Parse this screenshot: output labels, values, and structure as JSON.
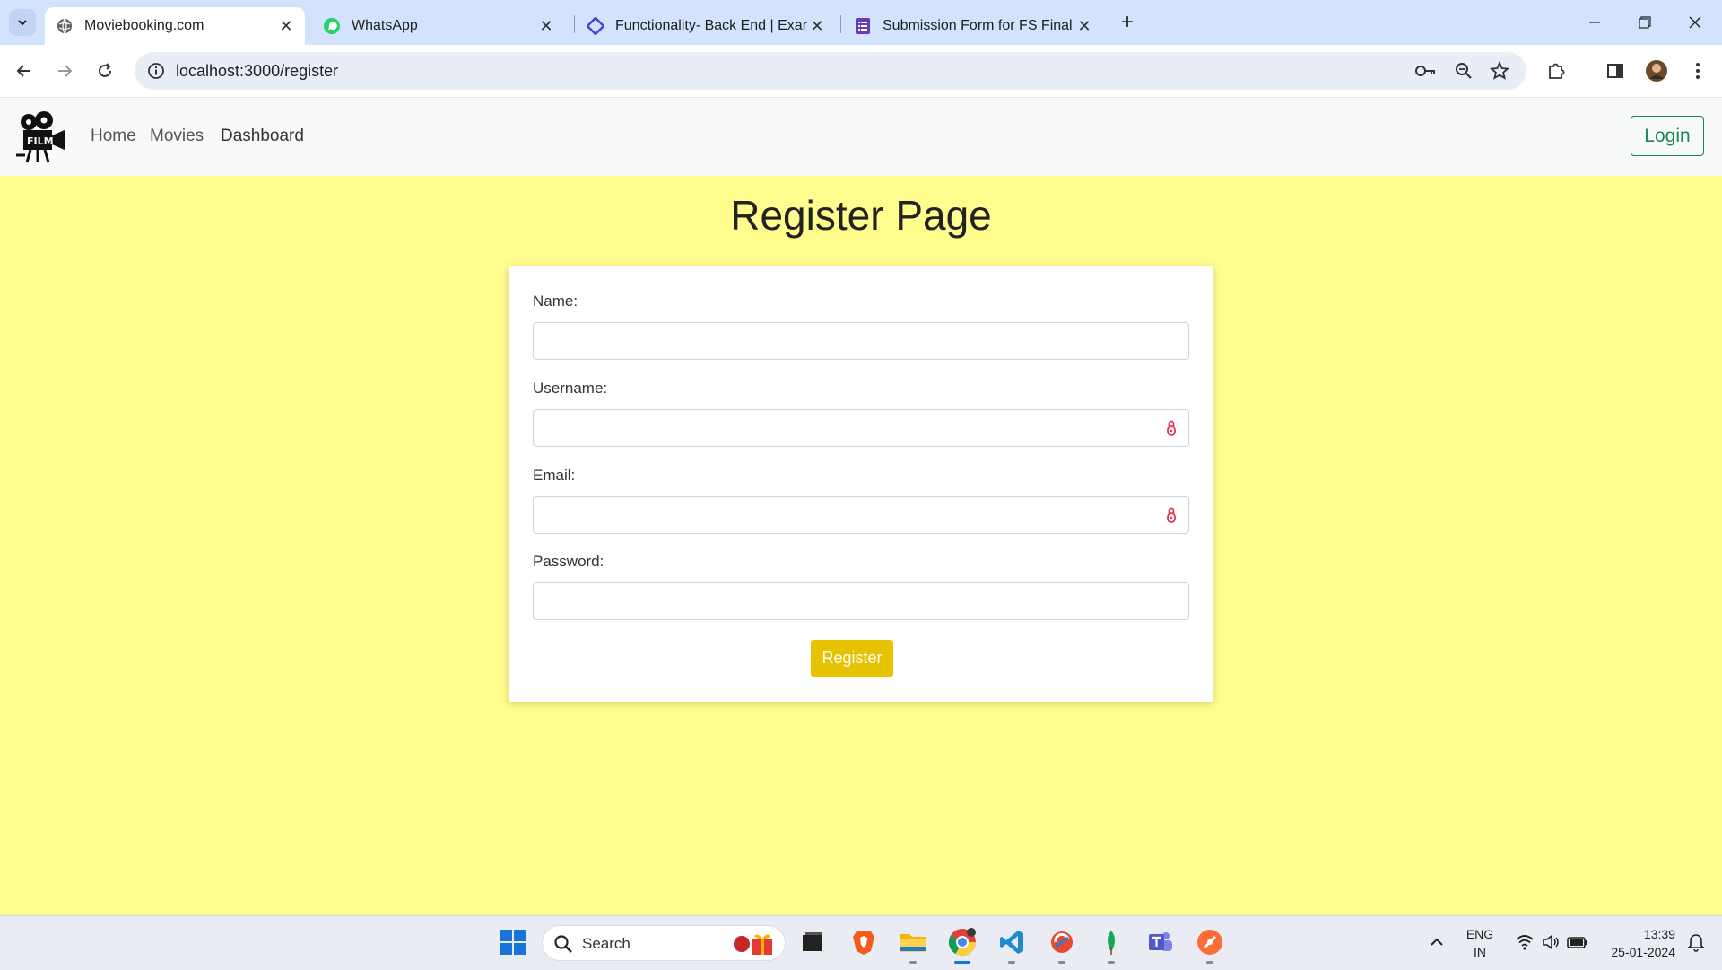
{
  "browser": {
    "tabs": [
      {
        "title": "Moviebooking.com",
        "favicon": "globe-icon",
        "active": true
      },
      {
        "title": "WhatsApp",
        "favicon": "whatsapp-icon",
        "active": false
      },
      {
        "title": "Functionality- Back End | Exam",
        "favicon": "diamond-code-icon",
        "active": false
      },
      {
        "title": "Submission Form for FS Final Ex",
        "favicon": "forms-icon",
        "active": false
      }
    ],
    "url": "localhost:3000/register"
  },
  "navbar": {
    "brand_logo_text": "FILM",
    "links": [
      "Home",
      "Movies",
      "Dashboard"
    ],
    "login_label": "Login"
  },
  "page": {
    "title": "Register Page",
    "form": {
      "fields": [
        {
          "label": "Name:",
          "value": "",
          "has_password_manager_icon": false
        },
        {
          "label": "Username:",
          "value": "",
          "has_password_manager_icon": true
        },
        {
          "label": "Email:",
          "value": "",
          "has_password_manager_icon": true
        },
        {
          "label": "Password:",
          "value": "",
          "has_password_manager_icon": false
        }
      ],
      "submit_label": "Register"
    }
  },
  "taskbar": {
    "search_label": "Search",
    "language": "ENG",
    "region": "IN",
    "time": "13:39",
    "date": "25-01-2024"
  },
  "colors": {
    "page_background": "#fffd8d",
    "register_button": "#e6c300",
    "login_button_border": "#198754"
  }
}
